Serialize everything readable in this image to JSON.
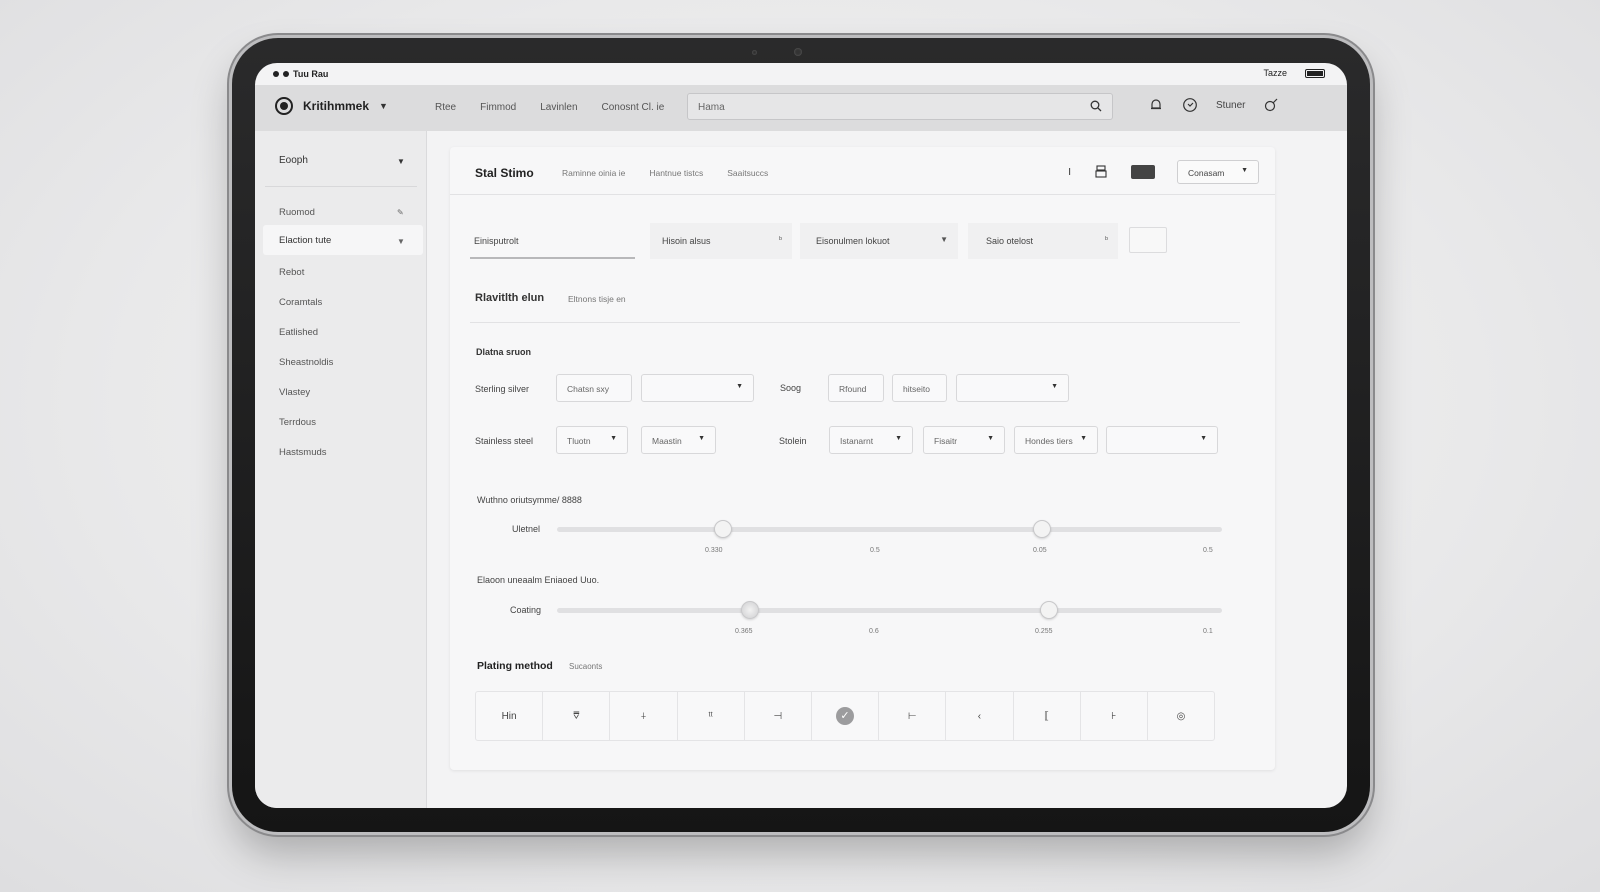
{
  "status": {
    "left_text": "Tuu Rau",
    "right_text": "Tazze"
  },
  "topnav": {
    "brand": "Kritihmmek",
    "links": [
      "Rtee",
      "Fimmod",
      "Lavinlen",
      "Conosnt Cl. ie"
    ],
    "search_placeholder": "Hama",
    "user_label": "Stuner"
  },
  "sidebar": {
    "header": "Eooph",
    "items": [
      "Ruomod",
      "Elaction tute",
      "Rebot",
      "Coramtals",
      "Eatlished",
      "Sheastnoldis",
      "Vlastey",
      "Terrdous",
      "Hastsmuds"
    ]
  },
  "card": {
    "title": "Stal Stimo",
    "tabs": [
      "Raminne oinia ie",
      "Hantnue tistcs",
      "Saaitsuccs"
    ],
    "header_button": "Conasam"
  },
  "filters": {
    "f1": "Einisputrolt",
    "f2": "Hisoin alsus",
    "f3": "Eisonulmen lokuot",
    "f4": "Saio otelost"
  },
  "section": {
    "title": "Rlavitlth elun",
    "subtitle": "Eltnons tisje en",
    "group_label": "Dlatna sruon"
  },
  "materials": {
    "row1": {
      "label": "Sterling silver",
      "c1": "Chatsn sxy",
      "second_label": "Soog",
      "c3": "Rfound",
      "c4": "hitseito"
    },
    "row2": {
      "label": "Stainless steel",
      "c1": "Tluotn",
      "c2": "Maastin",
      "second_label": "Stolein",
      "c3": "Istanarnt",
      "c4": "Fisaitr",
      "c5": "Hondes tiers"
    }
  },
  "slider1": {
    "heading": "Wuthno oriutsymme/ 8888",
    "label": "Uletnel",
    "value": 0.25,
    "value2": 0.73,
    "ticks": [
      "0.330",
      "0.5",
      "0.05",
      "0.5"
    ]
  },
  "slider2": {
    "heading": "Elaoon uneaalm Eniaoed Uuo.",
    "label": "Coating",
    "value": 0.29,
    "value2": 0.74,
    "ticks": [
      "0.365",
      "0.6",
      "0.255",
      "0.1"
    ]
  },
  "plating": {
    "title": "Plating method",
    "subtitle": "Sucaonts",
    "options": [
      "Hin",
      "⩢",
      "⍭",
      "ᵗᵗ",
      "⊣",
      "✓",
      "⊢",
      "‹",
      "⟦",
      "⊦",
      "◎"
    ],
    "selected_index": 5
  }
}
